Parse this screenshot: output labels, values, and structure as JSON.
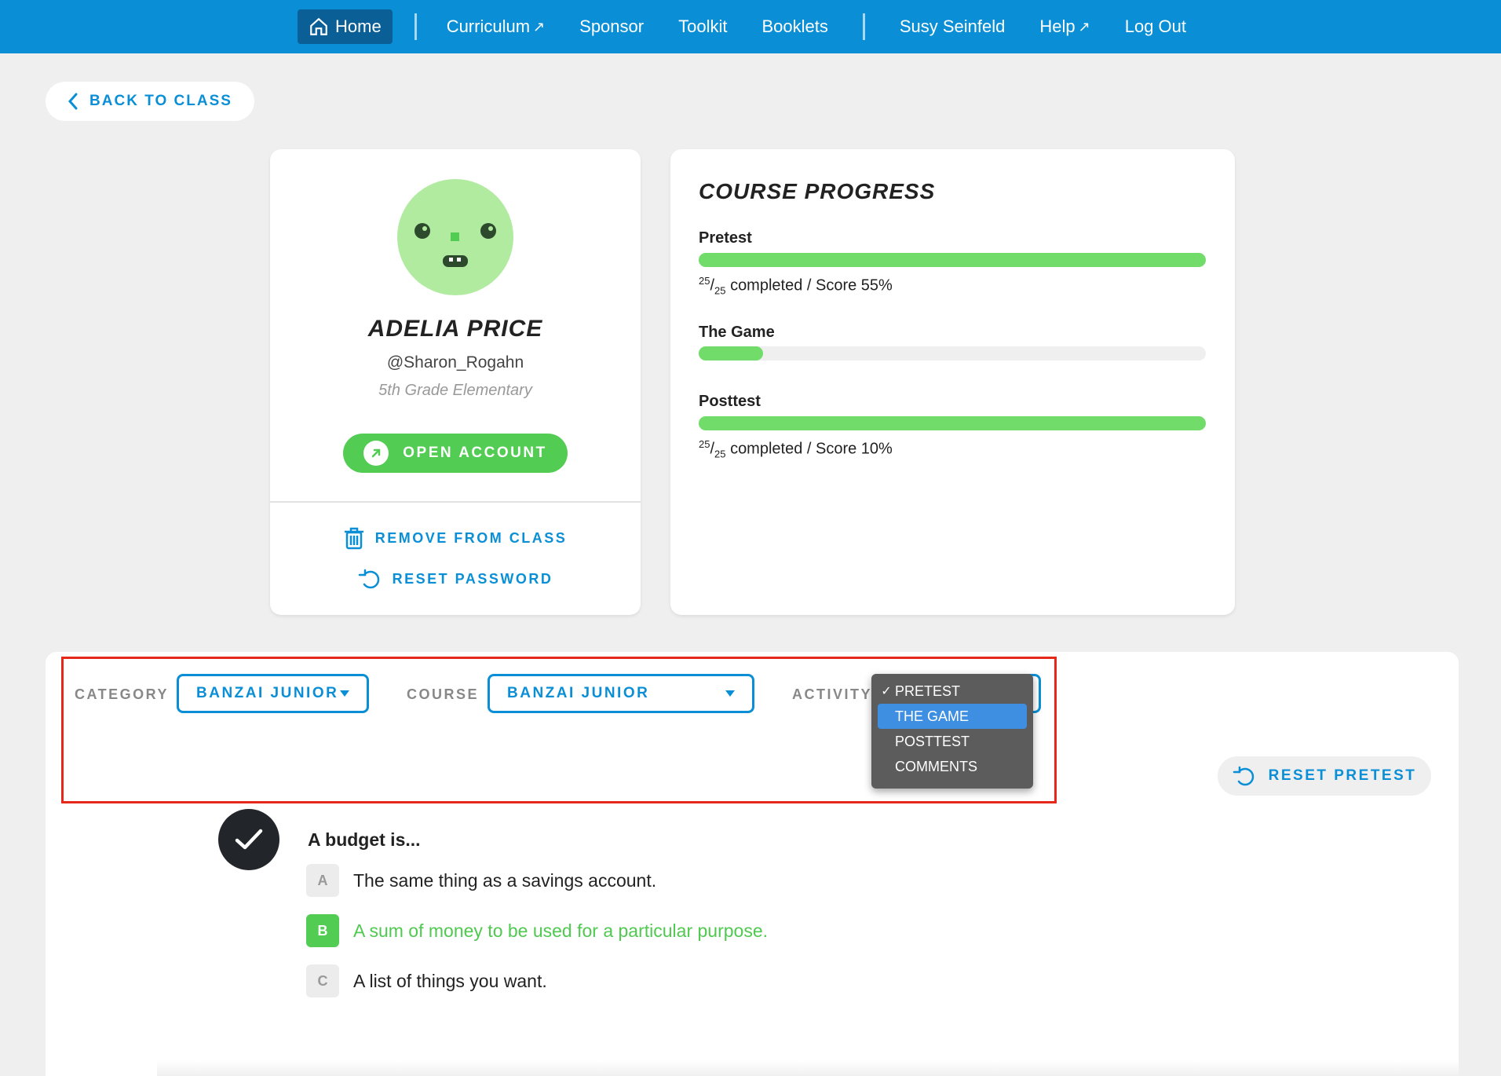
{
  "nav": {
    "home": "Home",
    "curriculum": "Curriculum",
    "sponsor": "Sponsor",
    "toolkit": "Toolkit",
    "booklets": "Booklets",
    "user": "Susy Seinfeld",
    "help": "Help",
    "logout": "Log Out",
    "ext_glyph": "↗"
  },
  "back_button": "BACK TO CLASS",
  "student": {
    "name": "ADELIA PRICE",
    "handle": "@Sharon_Rogahn",
    "grade": "5th Grade Elementary",
    "open_account": "OPEN ACCOUNT",
    "remove": "REMOVE FROM CLASS",
    "reset_password": "RESET PASSWORD"
  },
  "progress": {
    "title": "COURSE PROGRESS",
    "items": [
      {
        "label": "Pretest",
        "fill": 1.0,
        "done": "25",
        "total": "25",
        "text": "completed / Score 55%"
      },
      {
        "label": "The Game",
        "fill": 0.127
      },
      {
        "label": "Posttest",
        "fill": 1.0,
        "done": "25",
        "total": "25",
        "text": "completed / Score 10%"
      }
    ]
  },
  "filters": {
    "category_label": "CATEGORY",
    "category_value": "BANZAI JUNIOR",
    "course_label": "COURSE",
    "course_value": "BANZAI JUNIOR",
    "activity_label": "ACTIVITY",
    "activity_options": [
      "PRETEST",
      "THE GAME",
      "POSTTEST",
      "COMMENTS"
    ],
    "activity_checked": "PRETEST",
    "activity_highlighted": "THE GAME"
  },
  "reset_pretest": "RESET PRETEST",
  "question": {
    "text": "A budget is...",
    "answers": [
      {
        "letter": "A",
        "text": "The same thing as a savings account.",
        "correct": false
      },
      {
        "letter": "B",
        "text": "A sum of money to be used for a particular purpose.",
        "correct": true
      },
      {
        "letter": "C",
        "text": "A list of things you want.",
        "correct": false
      }
    ]
  },
  "colors": {
    "nav_bg": "#0a8fd6",
    "accent": "#0a8fd6",
    "success": "#52cc52",
    "highlight": "#e8271b"
  }
}
